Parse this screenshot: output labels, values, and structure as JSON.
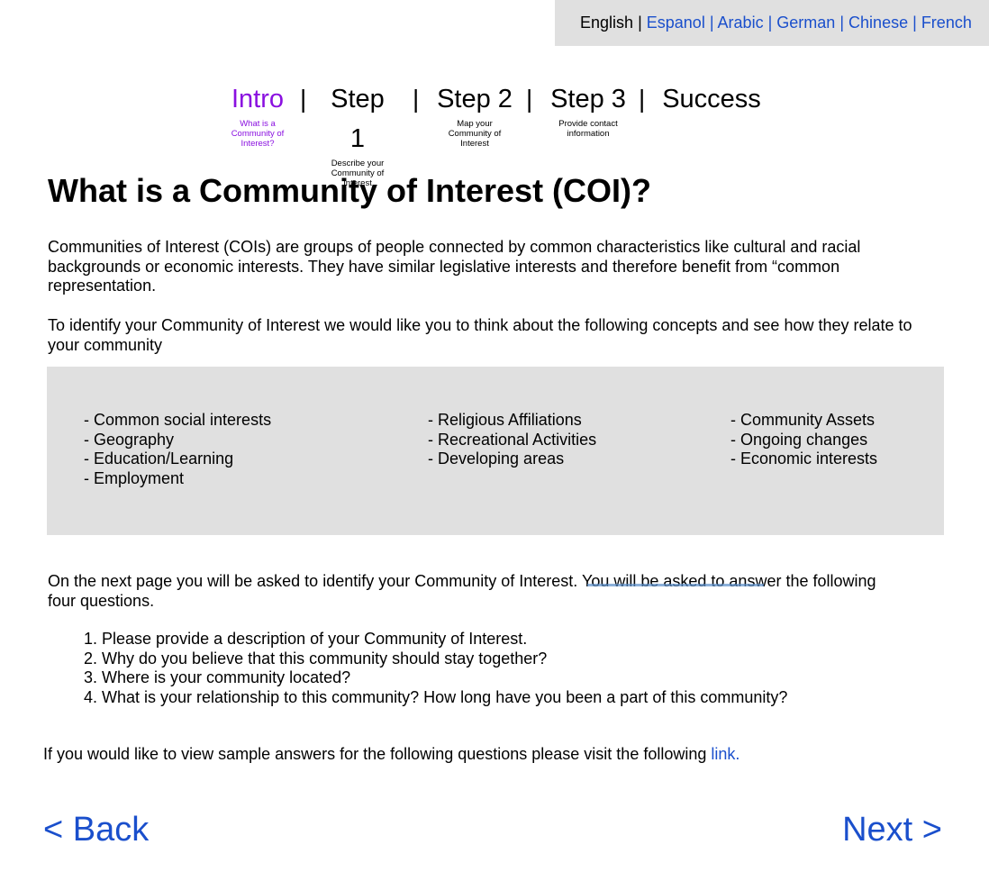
{
  "languages": {
    "current": "English",
    "separator": "|",
    "options": [
      "Espanol",
      "Arabic",
      "German",
      "Chinese",
      "French"
    ]
  },
  "steps": {
    "separator": "|",
    "items": [
      {
        "label": "Intro",
        "sub": "What is a Community of Interest?"
      },
      {
        "label": "Step 1",
        "sub": "Describe your Community of Interest"
      },
      {
        "label": "Step 2",
        "sub": "Map your Community of Interest"
      },
      {
        "label": "Step 3",
        "sub": "Provide contact information"
      },
      {
        "label": "Success",
        "sub": ""
      }
    ],
    "active_color": "#8a10e0"
  },
  "main": {
    "title": "What is a Community of Interest (COI)?",
    "intro": "Communities of Interest (COIs) are groups of people connected by common characteristics like cultural and racial backgrounds or economic interests. They have similar legislative interests and therefore benefit from “common representation.",
    "identify": "To identify your Community of Interest we would like you to think about the following concepts and see how they relate to your community",
    "concepts": [
      [
        "- Common social interests",
        "- Geography",
        "- Education/Learning",
        "- Employment"
      ],
      [
        "- Religious Affiliations",
        "- Recreational Activities",
        "- Developing areas"
      ],
      [
        "- Community Assets",
        "- Ongoing changes",
        "- Economic interests"
      ]
    ],
    "next_page": "On the next page you will be asked to identify your Community of Interest. You will be asked to answer the following four questions.",
    "questions": [
      "1. Please provide a description of your Community of Interest.",
      "2. Why do you believe that this community should stay together?",
      "3. Where is your community located?",
      "4. What is your relationship to this community? How long have you been a part of this community?"
    ],
    "sample_text": "If you would like to view sample answers for the following questions please visit the following ",
    "sample_link": "link."
  },
  "nav": {
    "back": "< Back",
    "next": "Next >"
  },
  "colors": {
    "link": "#1a4fcc",
    "panel": "#e0e0e0"
  }
}
